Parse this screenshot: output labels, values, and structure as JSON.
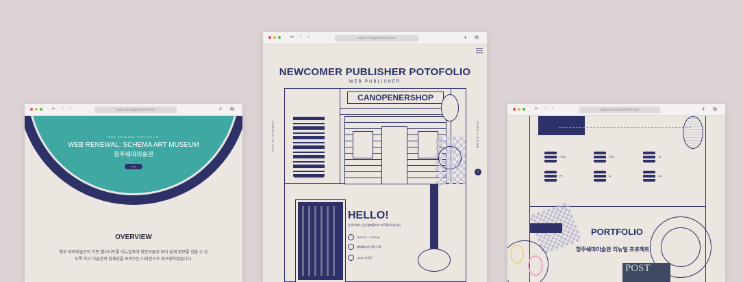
{
  "browser": {
    "nav_icons": "⇤ ‹ ›",
    "right_icons": "+ ⧉"
  },
  "window1": {
    "url": "ezgif.com/ezgif-website.html",
    "hero_small": "WEB RENEWAL PORTFOLIO",
    "hero_title": "WEB RENEWAL: SCHEMA ART MUSEUM",
    "hero_title_ko": "청주쉐마미술관",
    "hero_button": "more",
    "overview_title": "OVERVIEW",
    "overview_text": "청주 쉐마미술관의 기존 웹사이트를 리뉴얼하여 방문자들이 보다 쉽게 정보를 얻을 수 있도록 하고 미술관의 정체성을 보여주는 디자인으로 재구성하였습니다."
  },
  "window2": {
    "url": "ezgif.com/ezgif-website.html",
    "title": "NEWCOMER PUBLISHER POTOFOLIO",
    "subtitle": "WEB PUBLISHER",
    "shop_sign": "CANOPENERSHOP",
    "side_left": "PORTFOLIO 2023",
    "side_right": "SCROLL DOWN",
    "next_icon": "›",
    "hello": "HELLO!",
    "hello_sub": "안녕하세요 신입 웹퍼블리셔 포트폴리오입니다.",
    "info_items": [
      "2023.03 ~ 2023.08",
      "웹퍼블리셔 과정 수료",
      "UI/UX 디자인"
    ]
  },
  "window3": {
    "url": "ezgif.com/ezgif-website.html",
    "skills": [
      {
        "label": "HTML"
      },
      {
        "label": "CSS"
      },
      {
        "label": "JS"
      },
      {
        "label": "PS"
      },
      {
        "label": "AI"
      },
      {
        "label": "XD"
      }
    ],
    "portfolio_title": "PORTFOLIO",
    "portfolio_ko": "청주쉐마미술관 리뉴얼 프로젝트",
    "post_label": "POST"
  },
  "colors": {
    "navy": "#2e3167",
    "teal": "#3fa8a3",
    "paper": "#ece6e1",
    "background": "#ddd3d5"
  }
}
